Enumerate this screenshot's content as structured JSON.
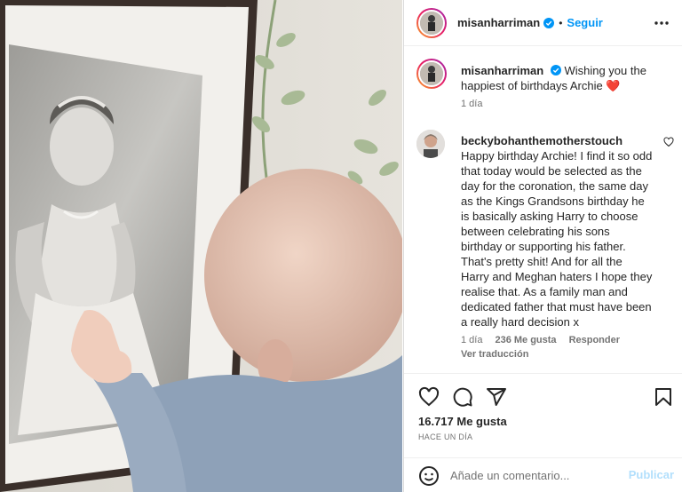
{
  "post": {
    "author": "misanharriman",
    "follow_label": "Seguir",
    "separator": "•",
    "more_icon": "more-horizontal-icon",
    "verified_icon": "verified-badge-icon"
  },
  "caption": {
    "username": "misanharriman",
    "text": "Wishing you the happiest of birthdays Archie",
    "emoji": "❤️",
    "time": "1 día"
  },
  "comment": {
    "username": "beckybohanthemotherstouch",
    "text": "Happy birthday Archie! I find it so odd that today would be selected as the day for the coronation, the same day as the Kings Grandsons birthday he is basically asking Harry to choose between celebrating his sons birthday or supporting his father. That's pretty shit! And for all the Harry and Meghan haters I hope they realise that. As a family man and dedicated father that must have been a really hard decision x",
    "time": "1 día",
    "likes": "236 Me gusta",
    "reply": "Responder",
    "translate": "Ver traducción"
  },
  "actions": {
    "like_count": "16.717 Me gusta",
    "posted_when": "HACE UN DÍA",
    "icons": [
      "heart-icon",
      "comment-icon",
      "share-icon",
      "bookmark-icon"
    ]
  },
  "comment_box": {
    "placeholder": "Añade un comentario...",
    "publish_label": "Publicar"
  },
  "colors": {
    "link_blue": "#0095f6",
    "publish_disabled": "#b2dffc",
    "heart_red": "#d0142b"
  }
}
